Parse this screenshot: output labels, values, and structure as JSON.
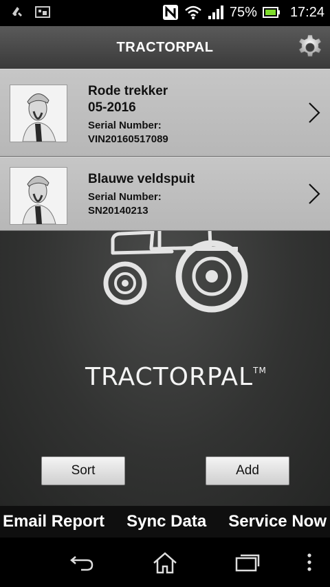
{
  "status": {
    "battery": "75%",
    "time": "17:24"
  },
  "app": {
    "title": "TRACTORPAL"
  },
  "items": [
    {
      "name": "Rode trekker",
      "date": "05-2016",
      "serial_label": "Serial Number:",
      "serial": "VIN20160517089"
    },
    {
      "name": "Blauwe veldspuit",
      "serial_label": "Serial Number:",
      "serial": "SN20140213"
    }
  ],
  "logo": {
    "text": "TRACTORPAL",
    "trademark": "TM"
  },
  "buttons": {
    "sort": "Sort",
    "add": "Add"
  },
  "actions": {
    "email": "Email Report",
    "sync": "Sync Data",
    "service": "Service Now"
  },
  "icons": {
    "settings": "gear-icon",
    "chevron": "chevron-right-icon",
    "back": "back-icon",
    "home": "home-icon",
    "recents": "recent-apps-icon",
    "menu": "overflow-menu-icon"
  }
}
